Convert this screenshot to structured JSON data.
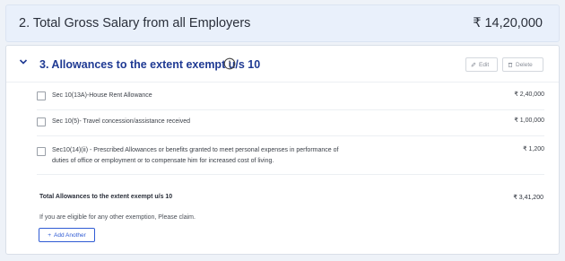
{
  "gross": {
    "title": "2. Total Gross Salary from all Employers",
    "amount": "₹ 14,20,000"
  },
  "allowances": {
    "title": "3. Allowances to the extent exempt u/s 10",
    "edit_label": "Edit",
    "delete_label": "Delete",
    "rows": [
      {
        "label": "Sec 10(13A)-House Rent Allowance",
        "value": "₹ 2,40,000"
      },
      {
        "label": "Sec 10(5)- Travel concession/assistance received",
        "value": "₹ 1,00,000"
      },
      {
        "label_line1": "Sec10(14)(ii) - Prescribed Allowances or benefits granted to meet personal expenses in performance of",
        "label_line2": "duties of office or employment or to compensate him for increased cost of living.",
        "value": "₹ 1,200"
      }
    ],
    "total_label": "Total Allowances to the extent exempt u/s 10",
    "total_value": "₹ 3,41,200",
    "claim_text": "If you are eligible for any other exemption, Please claim.",
    "add_label": "Add Another"
  }
}
